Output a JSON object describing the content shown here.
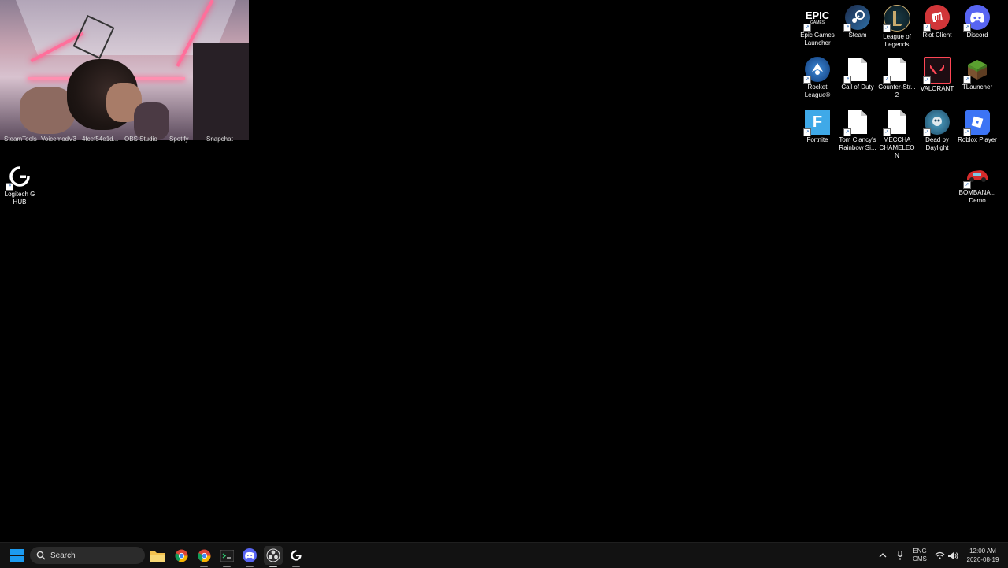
{
  "desktop": {
    "icons_left": [
      {
        "label": "Logitech G HUB",
        "icon": "logitech-g-icon"
      }
    ],
    "hidden_labels": [
      "SteamTools",
      "VoicemodV3",
      "4fcef54e1d...",
      "OBS Studio",
      "Spotify",
      "Snapchat"
    ],
    "icons_right": [
      {
        "label": "Epic Games Launcher",
        "icon": "epic-games-icon"
      },
      {
        "label": "Steam",
        "icon": "steam-icon"
      },
      {
        "label": "League of Legends",
        "icon": "league-of-legends-icon"
      },
      {
        "label": "Riot Client",
        "icon": "riot-client-icon"
      },
      {
        "label": "Discord",
        "icon": "discord-icon"
      },
      {
        "label": "Rocket League®",
        "icon": "rocket-league-icon"
      },
      {
        "label": "Call of Duty",
        "icon": "blank-document-icon"
      },
      {
        "label": "Counter-Str... 2",
        "icon": "blank-document-icon"
      },
      {
        "label": "VALORANT",
        "icon": "valorant-icon"
      },
      {
        "label": "TLauncher",
        "icon": "tlauncher-grass-block-icon"
      },
      {
        "label": "Fortnite",
        "icon": "fortnite-icon"
      },
      {
        "label": "Tom Clancy's Rainbow Si...",
        "icon": "blank-document-icon"
      },
      {
        "label": "MECCHA CHAMELEON",
        "icon": "blank-document-icon"
      },
      {
        "label": "Dead by Daylight",
        "icon": "dead-by-daylight-icon"
      },
      {
        "label": "Roblox Player",
        "icon": "roblox-icon"
      },
      {
        "label": "BOMBANA... Demo",
        "icon": "bombana-car-icon"
      }
    ],
    "epic_text": "EPIC",
    "epic_sub": "GAMES",
    "fortnite_letter": "F"
  },
  "taskbar": {
    "search_placeholder": "Search",
    "apps": [
      "start-icon",
      "file-explorer-icon",
      "chrome-icon",
      "chrome-profile-icon",
      "terminal-icon",
      "discord-icon",
      "obs-icon",
      "logitech-g-icon"
    ],
    "tray": {
      "lang_top": "ENG",
      "lang_bottom": "CMS",
      "time": "12:00 AM",
      "date": "2026-08-19"
    }
  },
  "colors": {
    "desktop_bg": "#000000",
    "taskbar_bg": "#121212",
    "discord": "#5865F2",
    "riot": "#D13639",
    "roblox": "#3C74F5",
    "fortnite": "#3FA9E8",
    "start": "#1C9BF0"
  }
}
